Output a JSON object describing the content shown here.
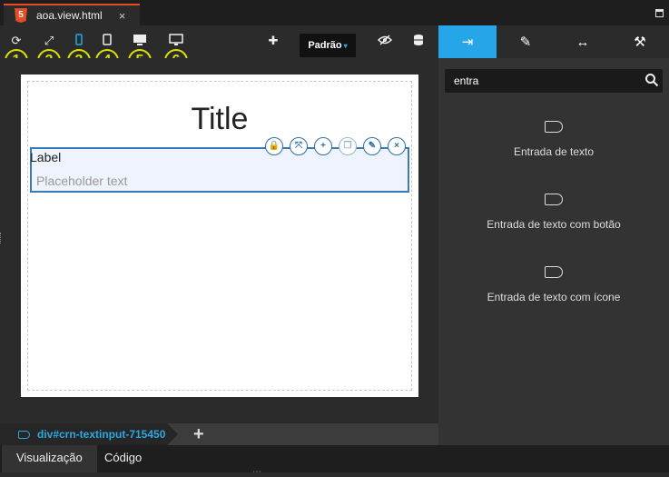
{
  "tab": {
    "filename": "aoa.view.html",
    "close": "×",
    "html5_badge": "5"
  },
  "toolbar": {
    "refresh_glyph": "⟳",
    "expand_glyph": "⤢",
    "add_glyph": "✚",
    "preset": "Padrão",
    "preset_caret": "▾",
    "device_numbers": [
      "1",
      "2",
      "3",
      "4",
      "5",
      "6"
    ]
  },
  "right_tabs": [
    {
      "name": "insert-tab",
      "glyph": "⇥",
      "active": true
    },
    {
      "name": "edit-tab",
      "glyph": "✎",
      "active": false
    },
    {
      "name": "resize-tab",
      "glyph": "↔",
      "active": false
    },
    {
      "name": "magic-tab",
      "glyph": "⚒",
      "active": false
    }
  ],
  "canvas": {
    "title": "Title",
    "label": "Label",
    "placeholder": "Placeholder text",
    "controls": [
      "🔒",
      "⤧",
      "+",
      "❐",
      "✎",
      "×"
    ]
  },
  "breadcrumb": {
    "path": "div#crn-textinput-715450",
    "add": "+"
  },
  "bottom_tabs": {
    "preview": "Visualização",
    "code": "Código"
  },
  "grip": "⋯",
  "search": {
    "value": "entra"
  },
  "components": [
    {
      "label": "Entrada de texto"
    },
    {
      "label": "Entrada de texto com botão"
    },
    {
      "label": "Entrada de texto com ícone"
    }
  ],
  "colors": {
    "accent": "#26a6e9",
    "highlight_ring": "#d8e000",
    "html5": "#e44d26"
  }
}
